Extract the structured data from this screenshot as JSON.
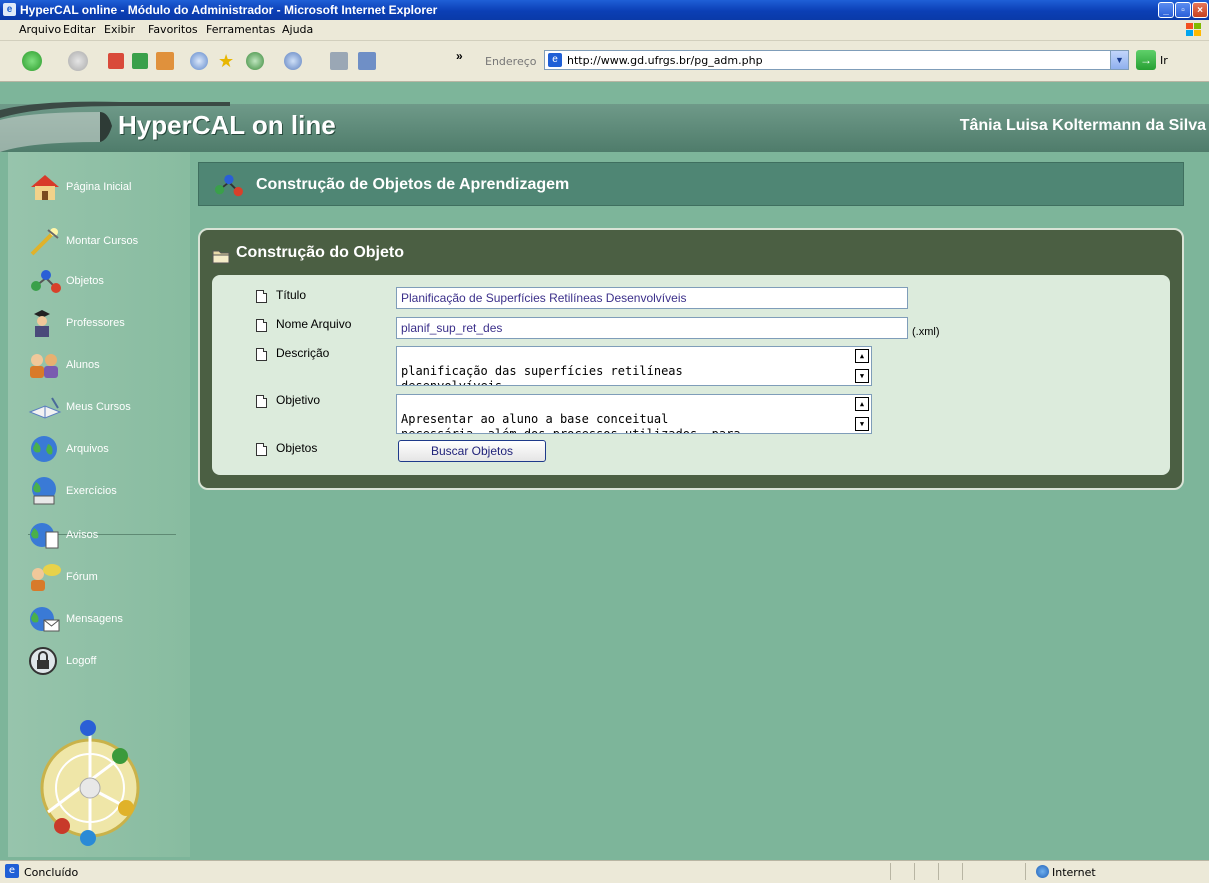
{
  "window": {
    "title": "HyperCAL online - Módulo do Administrador - Microsoft Internet Explorer"
  },
  "menu": [
    "Arquivo",
    "Editar",
    "Exibir",
    "Favoritos",
    "Ferramentas",
    "Ajuda"
  ],
  "address": {
    "label": "Endereço",
    "url": "http://www.gd.ufrgs.br/pg_adm.php",
    "go_label": "Ir"
  },
  "header": {
    "app_title": "HyperCAL on line",
    "user": "Tânia Luisa Koltermann da Silva"
  },
  "sidebar": {
    "items": [
      {
        "label": "Página Inicial",
        "icon": "home-icon"
      },
      {
        "label": "Montar Cursos",
        "icon": "magic-wand-icon"
      },
      {
        "label": "Objetos",
        "icon": "molecule-icon"
      },
      {
        "label": "Professores",
        "icon": "graduate-icon"
      },
      {
        "label": "Alunos",
        "icon": "students-icon"
      },
      {
        "label": "Meus Cursos",
        "icon": "open-book-icon"
      },
      {
        "label": "Arquivos",
        "icon": "globe-icon"
      },
      {
        "label": "Exercícios",
        "icon": "globe-pen-icon"
      },
      {
        "label": "Avisos",
        "icon": "globe-document-icon"
      },
      {
        "label": "Fórum",
        "icon": "forum-people-icon"
      },
      {
        "label": "Mensagens",
        "icon": "globe-mail-icon"
      },
      {
        "label": "Logoff",
        "icon": "lock-icon"
      }
    ]
  },
  "page": {
    "title": "Construção de Objetos de Aprendizagem"
  },
  "panel": {
    "title": "Construção do Objeto"
  },
  "form": {
    "titulo_label": "Título",
    "titulo_value": "Planificação de Superfícies Retilíneas Desenvolvíveis",
    "nome_label": "Nome Arquivo",
    "nome_value": "planif_sup_ret_des",
    "nome_suffix": "(.xml)",
    "descricao_label": "Descrição",
    "descricao_value": "planificação das superfícies retilíneas\ndesenvolvíveis.",
    "objetivo_label": "Objetivo",
    "objetivo_value": "Apresentar ao aluno a base conceitual\nnecessária, além dos processos utilizados, para",
    "objetos_label": "Objetos",
    "buscar_button": "Buscar Objetos"
  },
  "statusbar": {
    "status": "Concluído",
    "zone": "Internet"
  },
  "colors": {
    "header_green": "#4f8674",
    "panel_dark": "#4b5f43",
    "page_bg": "#7db59a",
    "input_text": "#3b2f8a"
  }
}
